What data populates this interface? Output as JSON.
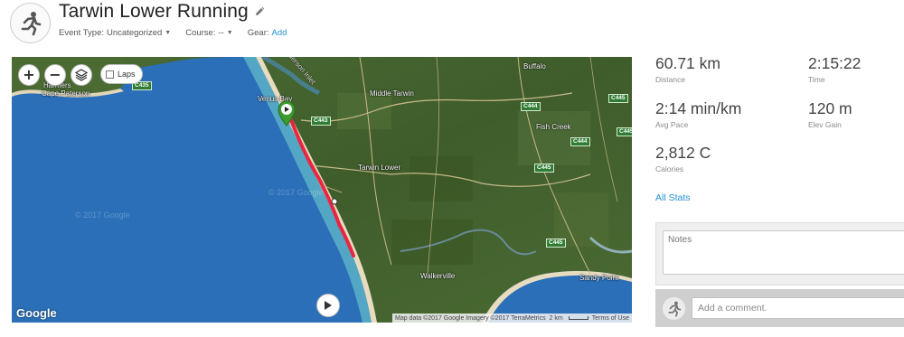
{
  "activity": {
    "icon": "running-icon",
    "title": "Tarwin Lower Running",
    "event_type_label": "Event Type:",
    "event_type_value": "Uncategorized",
    "course_label": "Course:",
    "course_value": "--",
    "gear_label": "Gear:",
    "gear_add": "Add"
  },
  "map": {
    "controls": {
      "zoom_in": "+",
      "zoom_out": "−",
      "laps_label": "Laps"
    },
    "place_labels": {
      "harmers": "Harmers",
      "cape_paterson": "Cape Paterson",
      "venus_bay": "Venus Bay",
      "middle_tarwin": "Middle Tarwin",
      "buffalo": "Buffalo",
      "fish_creek": "Fish Creek",
      "tarwin_lower": "Tarwin Lower",
      "walkerville": "Walkerville",
      "sandy_point": "Sandy Point",
      "inlet": "Anderson Inlet"
    },
    "road_badges": {
      "c435": "C435",
      "c443": "C443",
      "c444_a": "C444",
      "c444_b": "C444",
      "c445_a": "C445",
      "c445_b": "C445",
      "c445_c": "C445",
      "c445_d": "C445"
    },
    "watermark": "© 2017 Google",
    "logo": "Google",
    "attribution_data": "Map data ©2017 Google Imagery ©2017 TerraMetrics",
    "scale_label": "2 km",
    "terms": "Terms of Use",
    "route_color": "#e8263f",
    "sea_color": "#2a6fb8"
  },
  "stats": [
    {
      "value": "60.71 km",
      "label": "Distance"
    },
    {
      "value": "2:15:22",
      "label": "Time"
    },
    {
      "value": "2:14 min/km",
      "label": "Avg Pace"
    },
    {
      "value": "120 m",
      "label": "Elev Gain"
    },
    {
      "value": "2,812 C",
      "label": "Calories"
    }
  ],
  "all_stats_label": "All Stats",
  "notes": {
    "placeholder": "Notes"
  },
  "comment": {
    "placeholder": "Add a comment."
  }
}
